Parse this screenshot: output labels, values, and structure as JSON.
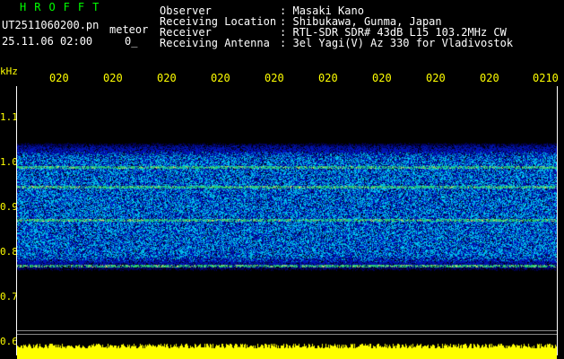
{
  "header": {
    "app_title": "HROFFT",
    "file_name": "UT2511060200.pn",
    "datetime": "25.11.06 02:00",
    "mode": "meteor",
    "minute_code": "0_"
  },
  "info": [
    {
      "key": "Observer",
      "sep": ":",
      "value": "Masaki Kano"
    },
    {
      "key": "Receiving Location",
      "sep": ":",
      "value": "Shibukawa, Gunma, Japan"
    },
    {
      "key": "Receiver",
      "sep": ":",
      "value": "RTL-SDR SDR# 43dB L15 103.2MHz CW"
    },
    {
      "key": "Receiving Antenna",
      "sep": ":",
      "value": "3el Yagi(V) Az 330 for Vladivostok"
    }
  ],
  "axis": {
    "y_unit": "kHz",
    "x_ticks": [
      "020",
      "020",
      "020",
      "020",
      "020",
      "020",
      "020",
      "020",
      "020",
      "0210"
    ],
    "y_ticks": [
      "1.1",
      "1.0",
      "0.9",
      "0.8",
      "0.7",
      "0.6"
    ]
  },
  "colors": {
    "text_label": "#ffffff",
    "title": "#00ff00",
    "axis_text": "#ffff00",
    "level_bar": "#ffff00",
    "background": "#000000"
  }
}
